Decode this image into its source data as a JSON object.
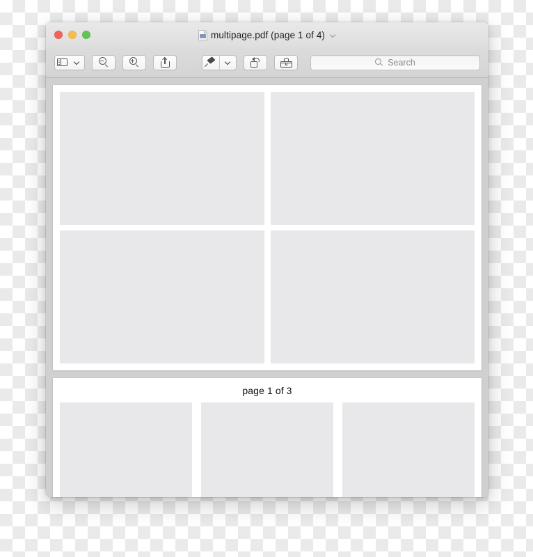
{
  "window": {
    "title": "multipage.pdf (page 1 of 4)",
    "title_chevron_icon": "chevron-down-icon",
    "document_icon": "pdf-document-icon",
    "traffic_lights": [
      {
        "name": "close",
        "color": "#f0655a"
      },
      {
        "name": "minimize",
        "color": "#f5bd4f"
      },
      {
        "name": "zoom",
        "color": "#61c555"
      }
    ]
  },
  "toolbar": {
    "sidebar_toggle": {
      "icon": "sidebar-icon",
      "chevron_icon": "chevron-down-icon"
    },
    "zoom_out": {
      "icon": "zoom-out-icon"
    },
    "zoom_in": {
      "icon": "zoom-in-icon"
    },
    "share": {
      "icon": "share-icon"
    },
    "markup_pen": {
      "icon": "pen-icon",
      "chevron_icon": "chevron-down-icon"
    },
    "rotate": {
      "icon": "rotate-left-icon"
    },
    "markup_toolbar": {
      "icon": "toolbox-icon"
    },
    "search": {
      "icon": "search-icon",
      "placeholder": "Search",
      "value": ""
    }
  },
  "document": {
    "pages": [
      {
        "id": "page-one",
        "label": "",
        "blocks": [
          {
            "id": "block-1"
          },
          {
            "id": "block-2"
          },
          {
            "id": "block-3"
          },
          {
            "id": "block-4"
          }
        ]
      },
      {
        "id": "page-two",
        "label": "page 1 of 3",
        "blocks": [
          {
            "id": "block-5"
          },
          {
            "id": "block-6"
          },
          {
            "id": "block-7"
          }
        ]
      }
    ]
  },
  "colors": {
    "doc_background": "#d0d0d0",
    "page_background": "#ffffff",
    "block_fill": "#e8e8ea",
    "toolbar_background": "#d8d8d8",
    "titlebar_background": "#e3e3e3"
  }
}
